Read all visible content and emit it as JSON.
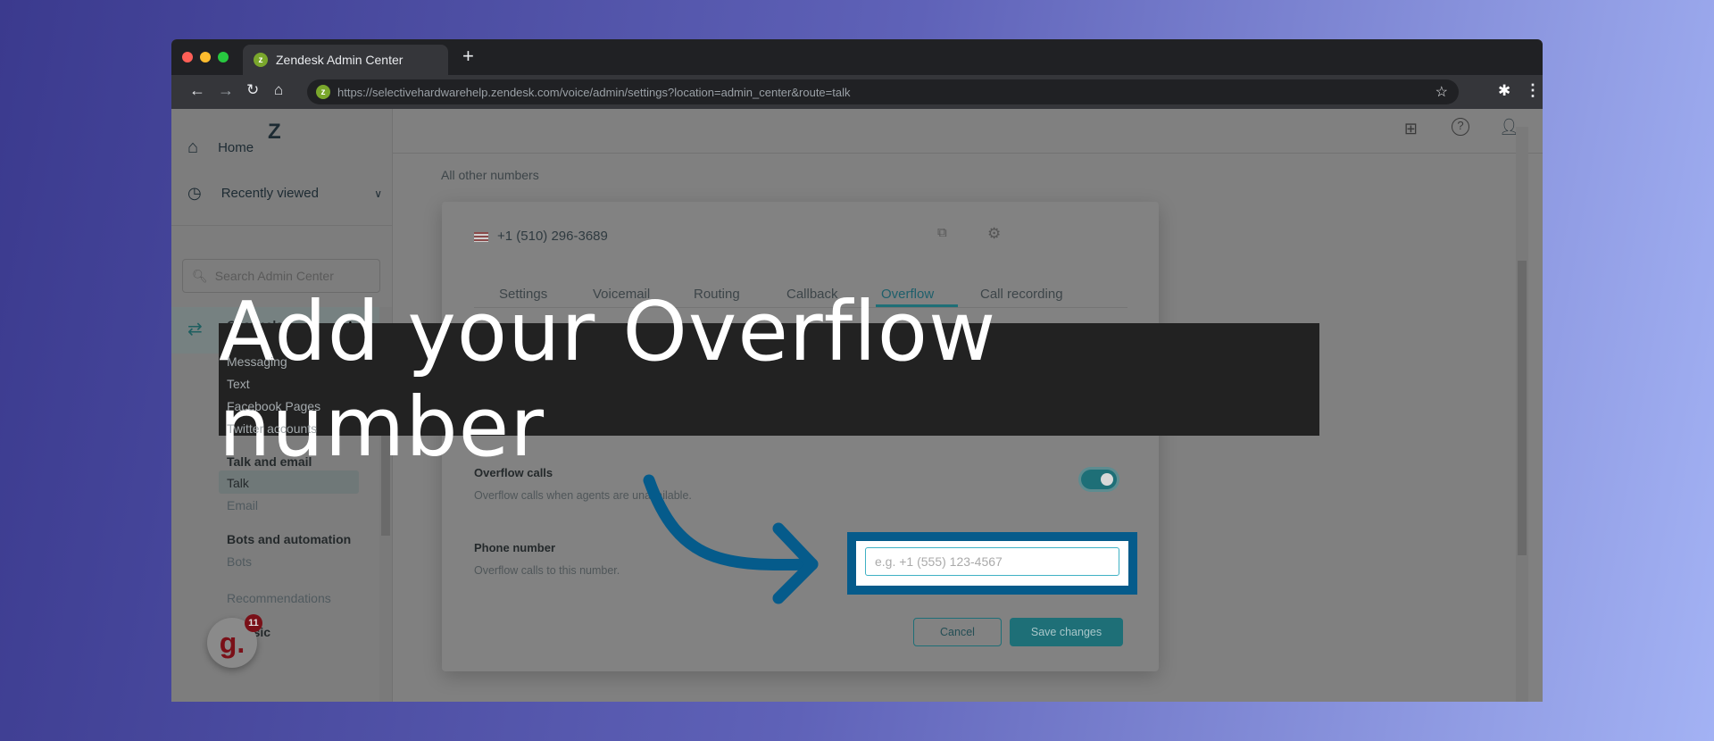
{
  "browser": {
    "tab_title": "Zendesk Admin Center",
    "new_tab": "+",
    "url": "https://selectivehardwarehelp.zendesk.com/voice/admin/settings?location=admin_center&route=talk"
  },
  "sidebar": {
    "home": "Home",
    "recently_viewed": "Recently viewed",
    "search_placeholder": "Search Admin Center",
    "channels": "Channels",
    "channel_items": [
      "Messaging",
      "Text",
      "Facebook Pages",
      "Twitter accounts"
    ],
    "talk_and_email": "Talk and email",
    "talk": "Talk",
    "email": "Email",
    "bots_and_automation": "Bots and automation",
    "bots": "Bots",
    "recommendations": "Recommendations",
    "classic": "Classic"
  },
  "grammarly": {
    "badge": "11",
    "letter": "g."
  },
  "main": {
    "section": "All other numbers",
    "phone": "+1 (510) 296-3689",
    "tabs": [
      "Settings",
      "Voicemail",
      "Routing",
      "Callback",
      "Overflow",
      "Call recording"
    ],
    "active_tab": "Overflow",
    "overflow_label": "Overflow calls",
    "overflow_desc": "Overflow calls when agents are unavailable.",
    "overflow_enabled": true,
    "phone_label": "Phone number",
    "phone_desc": "Overflow calls to this number.",
    "phone_placeholder": "e.g. +1 (555) 123-4567",
    "cancel": "Cancel",
    "save": "Save changes"
  },
  "overlay": {
    "banner": "Add your Overflow number"
  },
  "colors": {
    "accent": "#1f73b7",
    "highlight": "#055b8b",
    "teal": "#1e6f77"
  }
}
